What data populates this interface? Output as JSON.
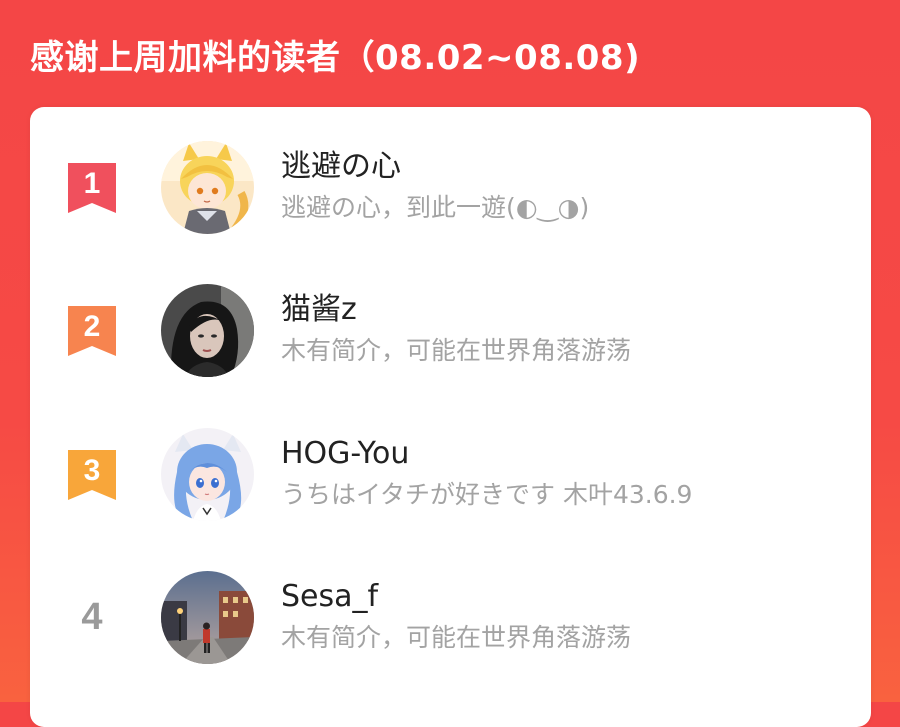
{
  "header": {
    "title": "感谢上周加料的读者（08.02~08.08)"
  },
  "colors": {
    "rank1": "#f0505d",
    "rank2": "#f7844f",
    "rank3": "#f8a63a",
    "rank_plain": "#9a9a9a",
    "background": "#f44646"
  },
  "readers": [
    {
      "rank": "1",
      "name": "逃避の心",
      "bio": "逃避の心，到此一遊(◐‿◑)",
      "avatar_icon": "anime-fox-boy-avatar"
    },
    {
      "rank": "2",
      "name": "猫酱z",
      "bio": "木有简介，可能在世界角落游荡",
      "avatar_icon": "woman-photo-avatar"
    },
    {
      "rank": "3",
      "name": "HOG-You",
      "bio": "うちはイタチが好きです 木叶43.6.9",
      "avatar_icon": "anime-blue-hair-girl-avatar"
    },
    {
      "rank": "4",
      "name": "Sesa_f",
      "bio": "木有简介，可能在世界角落游荡",
      "avatar_icon": "street-photo-avatar"
    }
  ]
}
